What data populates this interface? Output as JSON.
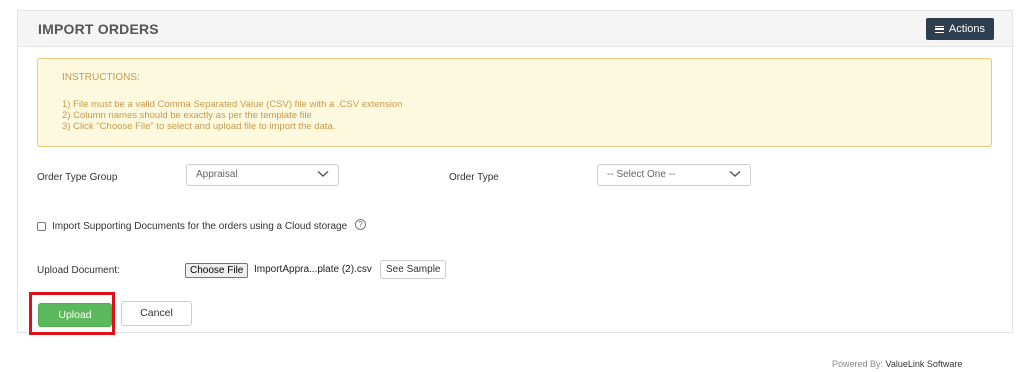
{
  "panel": {
    "title": "IMPORT ORDERS",
    "actions_label": "Actions"
  },
  "instructions": {
    "heading": "INSTRUCTIONS:",
    "lines": [
      "1) File must be a valid Comma Separated Value (CSV) file with a .CSV extension",
      "2) Column names should be exactly as per the template file",
      "3) Click \"Choose File\" to select and upload file to import the data."
    ]
  },
  "form": {
    "order_type_group_label": "Order Type Group",
    "order_type_group_value": "Appraisal",
    "order_type_label": "Order Type",
    "order_type_value": "-- Select One --",
    "cloud_checkbox_label": "Import Supporting Documents for the orders using a Cloud storage",
    "cloud_checkbox_checked": false,
    "upload_document_label": "Upload Document:",
    "choose_file_label": "Choose File",
    "file_name": "ImportAppra...plate (2).csv",
    "see_sample_label": "See Sample",
    "help_glyph": "?"
  },
  "buttons": {
    "upload": "Upload",
    "cancel": "Cancel"
  },
  "footer": {
    "prefix": "Powered By:",
    "brand": "ValueLink Software"
  },
  "colors": {
    "header_bg": "#f5f5f5",
    "actions_bg": "#2e3e4e",
    "instructions_bg": "#fdf9df",
    "instructions_border": "#e8c87a",
    "instructions_text": "#c89a4e",
    "upload_green": "#5cb85c",
    "highlight_red": "#e0101a"
  },
  "icons": {
    "actions": "hamburger-icon",
    "select_caret": "chevron-down-icon",
    "help": "question-circle-icon"
  }
}
